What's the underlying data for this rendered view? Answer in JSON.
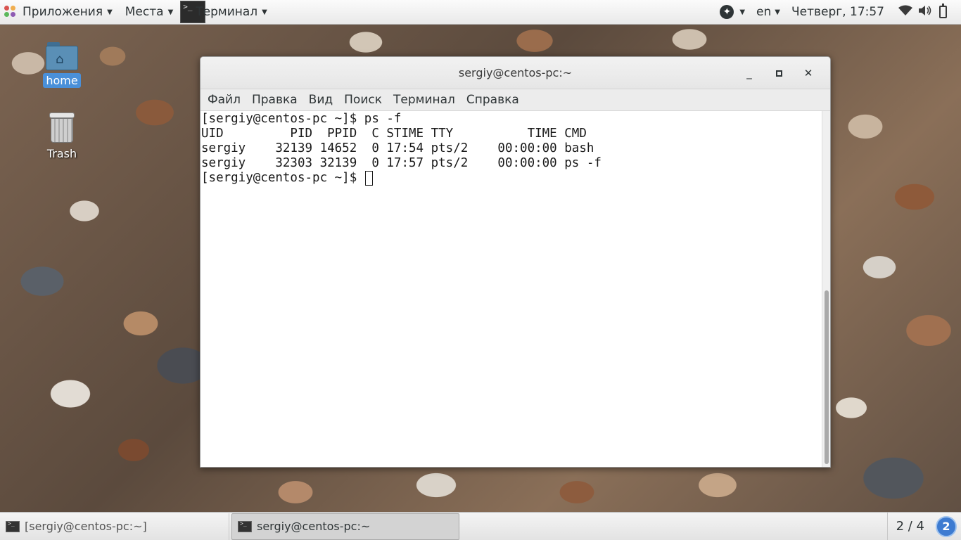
{
  "top_panel": {
    "applications_label": "Приложения",
    "places_label": "Места",
    "terminal_label": "Терминал",
    "language": "en",
    "datetime": "Четверг, 17:57"
  },
  "desktop": {
    "icons": [
      {
        "label": "home",
        "icon": "home-folder-icon",
        "selected": true
      },
      {
        "label": "Trash",
        "icon": "trash-icon",
        "selected": false
      }
    ]
  },
  "window": {
    "title": "sergiy@centos-pc:~",
    "menu": [
      "Файл",
      "Правка",
      "Вид",
      "Поиск",
      "Терминал",
      "Справка"
    ],
    "terminal_lines": [
      "[sergiy@centos-pc ~]$ ps -f",
      "UID         PID  PPID  C STIME TTY          TIME CMD",
      "sergiy    32139 14652  0 17:54 pts/2    00:00:00 bash",
      "sergiy    32303 32139  0 17:57 pts/2    00:00:00 ps -f"
    ],
    "prompt": "[sergiy@centos-pc ~]$ "
  },
  "bottom_panel": {
    "tasks": [
      {
        "label": "[sergiy@centos-pc:~]",
        "active": false
      },
      {
        "label": "sergiy@centos-pc:~",
        "active": true
      }
    ],
    "workspace": "2 / 4",
    "notification_count": "2"
  },
  "colors": {
    "selection_blue": "#4a90d9",
    "notification_blue": "#3d7bd1"
  }
}
